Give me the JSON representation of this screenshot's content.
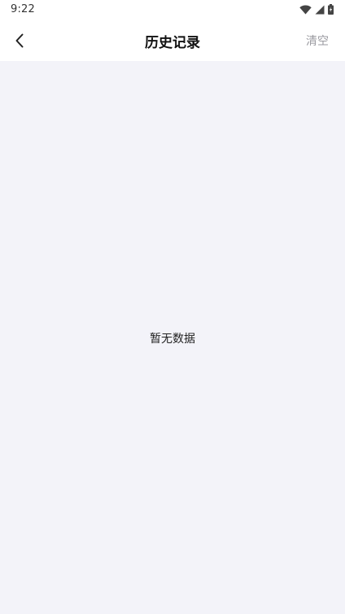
{
  "status_bar": {
    "time": "9:22",
    "icons": [
      "wifi-icon",
      "cellular-signal-icon",
      "battery-icon"
    ]
  },
  "app_bar": {
    "back_icon": "chevron-left-icon",
    "title": "历史记录",
    "clear_label": "清空"
  },
  "content": {
    "empty_message": "暂无数据"
  },
  "colors": {
    "background": "#f3f3f9",
    "surface": "#ffffff",
    "title_text": "#111111",
    "muted_text": "#9a9aa0"
  }
}
